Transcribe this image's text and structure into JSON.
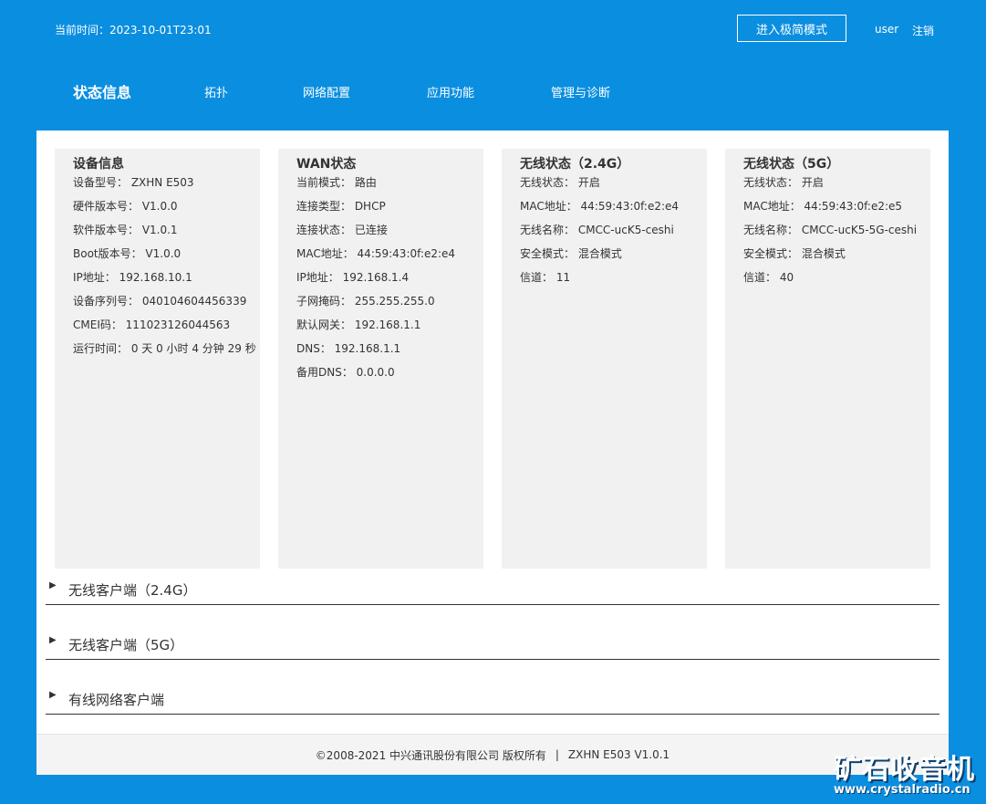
{
  "header": {
    "time_label": "当前时间：2023-10-01T23:01",
    "simple_mode_button": "进入极简模式",
    "user": "user",
    "logout": "注销"
  },
  "nav": {
    "items": [
      "状态信息",
      "拓扑",
      "网络配置",
      "应用功能",
      "管理与诊断"
    ],
    "active_index": 0
  },
  "cards": [
    {
      "title": "设备信息",
      "rows": [
        "设备型号： ZXHN E503",
        "硬件版本号： V1.0.0",
        "软件版本号： V1.0.1",
        "Boot版本号： V1.0.0",
        "IP地址： 192.168.10.1",
        "设备序列号： 040104604456339",
        "CMEI码： 111023126044563",
        "运行时间： 0 天 0 小时 4 分钟 29 秒"
      ]
    },
    {
      "title": "WAN状态",
      "rows": [
        "当前模式： 路由",
        "连接类型： DHCP",
        "连接状态： 已连接",
        "MAC地址： 44:59:43:0f:e2:e4",
        "IP地址： 192.168.1.4",
        "子网掩码： 255.255.255.0",
        "默认网关： 192.168.1.1",
        "DNS： 192.168.1.1",
        "备用DNS： 0.0.0.0"
      ]
    },
    {
      "title": "无线状态（2.4G）",
      "rows": [
        "无线状态： 开启",
        "MAC地址： 44:59:43:0f:e2:e4",
        "无线名称： CMCC-ucK5-ceshi",
        "安全模式： 混合模式",
        "信道： 11"
      ]
    },
    {
      "title": "无线状态（5G）",
      "rows": [
        "无线状态： 开启",
        "MAC地址： 44:59:43:0f:e2:e5",
        "无线名称： CMCC-ucK5-5G-ceshi",
        "安全模式： 混合模式",
        "信道： 40"
      ]
    }
  ],
  "accordions": [
    "无线客户端（2.4G）",
    "无线客户端（5G）",
    "有线网络客户端"
  ],
  "footer": {
    "copyright": "©2008-2021 中兴通讯股份有限公司 版权所有",
    "separator": "|",
    "model_version": "ZXHN E503 V1.0.1"
  },
  "watermark": {
    "title": "矿石收音机",
    "url": "www.crystalradio.cn"
  }
}
